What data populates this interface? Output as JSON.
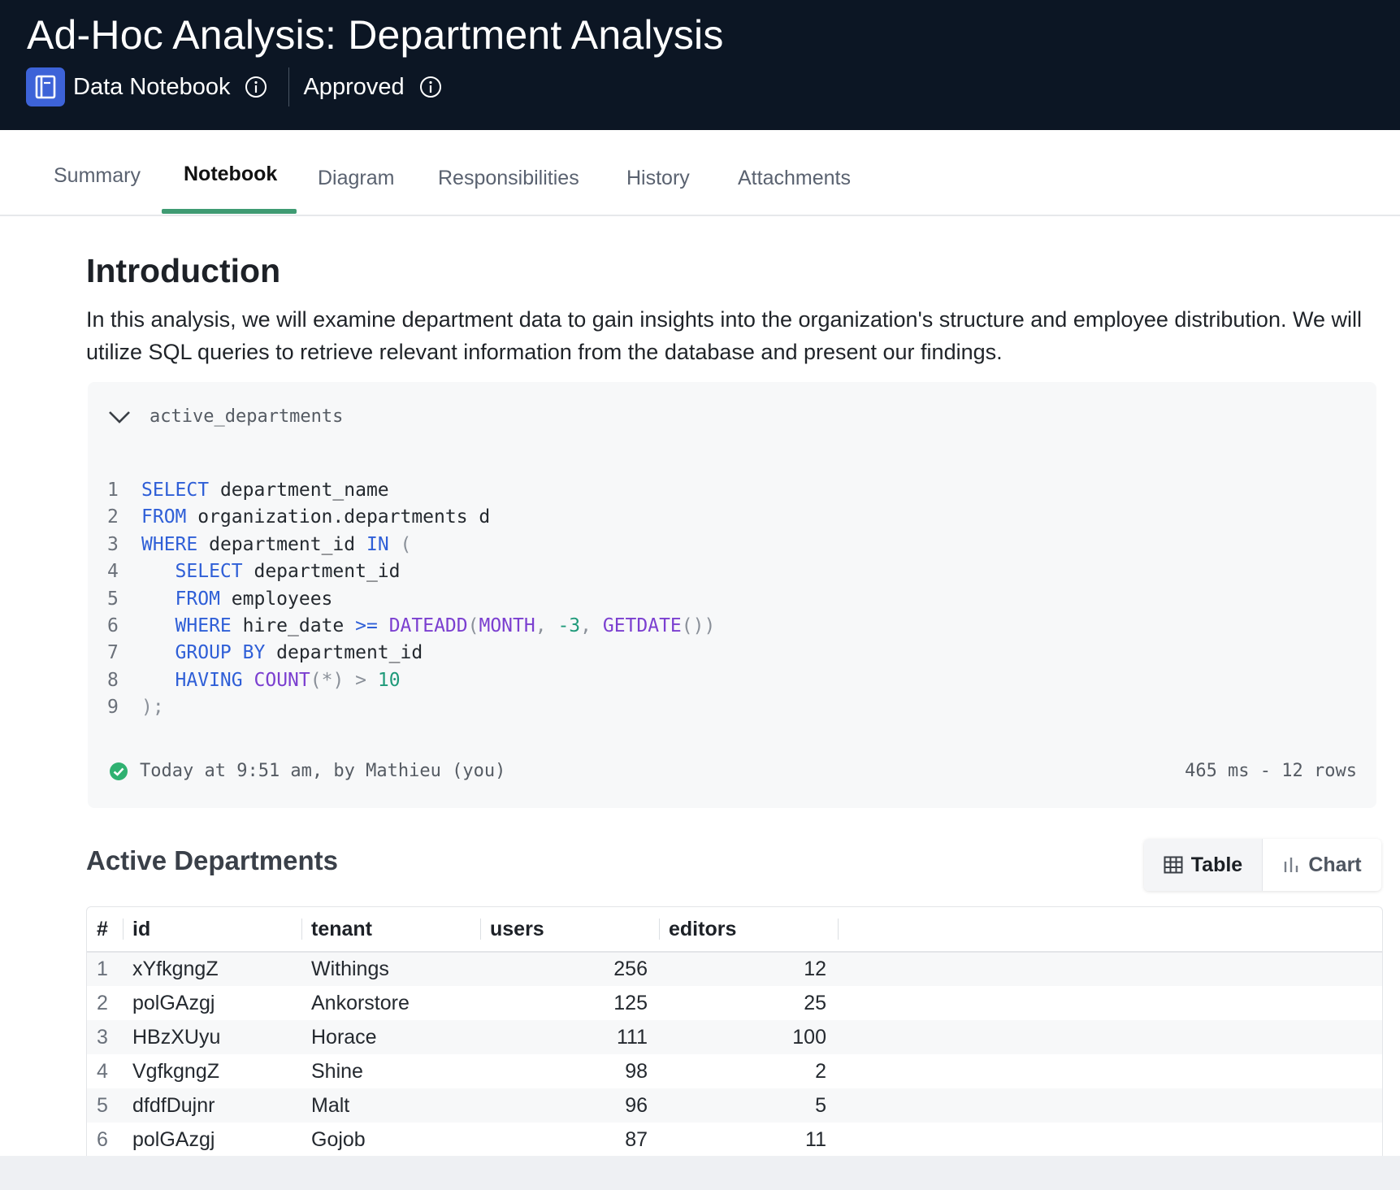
{
  "header": {
    "title": "Ad-Hoc Analysis: Department Analysis",
    "type_label": "Data Notebook",
    "status_label": "Approved"
  },
  "tabs": [
    {
      "label": "Summary"
    },
    {
      "label": "Notebook",
      "active": true
    },
    {
      "label": "Diagram"
    },
    {
      "label": "Responsibilities"
    },
    {
      "label": "History"
    },
    {
      "label": "Attachments"
    }
  ],
  "intro": {
    "heading": "Introduction",
    "paragraph": "In this analysis, we will examine department data to gain insights into the organization's structure and employee distribution. We will utilize SQL queries to retrieve relevant information from the database and present our findings."
  },
  "cell": {
    "name": "active_departments",
    "code_lines": [
      {
        "n": "1",
        "tokens": [
          [
            "kw",
            "SELECT"
          ],
          [
            "tx",
            " department_name"
          ]
        ]
      },
      {
        "n": "2",
        "tokens": [
          [
            "kw",
            "FROM"
          ],
          [
            "tx",
            " organization.departments d"
          ]
        ]
      },
      {
        "n": "3",
        "tokens": [
          [
            "kw",
            "WHERE"
          ],
          [
            "tx",
            " department_id "
          ],
          [
            "kw",
            "IN"
          ],
          [
            "pu",
            " ("
          ]
        ]
      },
      {
        "n": "4",
        "tokens": [
          [
            "tx",
            "   "
          ],
          [
            "kw",
            "SELECT"
          ],
          [
            "tx",
            " department_id"
          ]
        ]
      },
      {
        "n": "5",
        "tokens": [
          [
            "tx",
            "   "
          ],
          [
            "kw",
            "FROM"
          ],
          [
            "tx",
            " employees"
          ]
        ]
      },
      {
        "n": "6",
        "tokens": [
          [
            "tx",
            "   "
          ],
          [
            "kw",
            "WHERE"
          ],
          [
            "tx",
            " hire_date "
          ],
          [
            "kw",
            ">="
          ],
          [
            "tx",
            " "
          ],
          [
            "fn",
            "DATEADD"
          ],
          [
            "pu",
            "("
          ],
          [
            "fn",
            "MONTH"
          ],
          [
            "pu",
            ", "
          ],
          [
            "num",
            "-3"
          ],
          [
            "pu",
            ", "
          ],
          [
            "fn",
            "GETDATE"
          ],
          [
            "pu",
            "())"
          ]
        ]
      },
      {
        "n": "7",
        "tokens": [
          [
            "tx",
            "   "
          ],
          [
            "kw",
            "GROUP BY"
          ],
          [
            "tx",
            " department_id"
          ]
        ]
      },
      {
        "n": "8",
        "tokens": [
          [
            "tx",
            "   "
          ],
          [
            "kw",
            "HAVING"
          ],
          [
            "tx",
            " "
          ],
          [
            "fn",
            "COUNT"
          ],
          [
            "pu",
            "(*)"
          ],
          [
            "tx",
            " "
          ],
          [
            "pu",
            ">"
          ],
          [
            "tx",
            " "
          ],
          [
            "num",
            "10"
          ]
        ]
      },
      {
        "n": "9",
        "tokens": [
          [
            "pu",
            ");"
          ]
        ]
      }
    ],
    "status_text": "Today at 9:51 am, by Mathieu (you)",
    "run_stats": "465 ms - 12 rows",
    "status_color": "#2fb171"
  },
  "result": {
    "heading": "Active Departments",
    "table_label": "Table",
    "chart_label": "Chart",
    "columns": [
      "#",
      "id",
      "tenant",
      "users",
      "editors"
    ],
    "rows": [
      [
        "1",
        "xYfkgngZ",
        "Withings",
        "256",
        "12"
      ],
      [
        "2",
        "polGAzgj",
        "Ankorstore",
        "125",
        "25"
      ],
      [
        "3",
        "HBzXUyu",
        "Horace",
        "111",
        "100"
      ],
      [
        "4",
        "VgfkgngZ",
        "Shine",
        "98",
        "2"
      ],
      [
        "5",
        "dfdfDujnr",
        "Malt",
        "96",
        "5"
      ],
      [
        "6",
        "polGAzgj",
        "Gojob",
        "87",
        "11"
      ]
    ]
  },
  "colors": {
    "header_bg": "#0c1624",
    "accent_tab": "#3f9b73",
    "notebook_icon_bg": "#3d63d8",
    "keyword": "#2f5fd7",
    "function": "#7b3fd0",
    "number": "#1f9a7a"
  }
}
